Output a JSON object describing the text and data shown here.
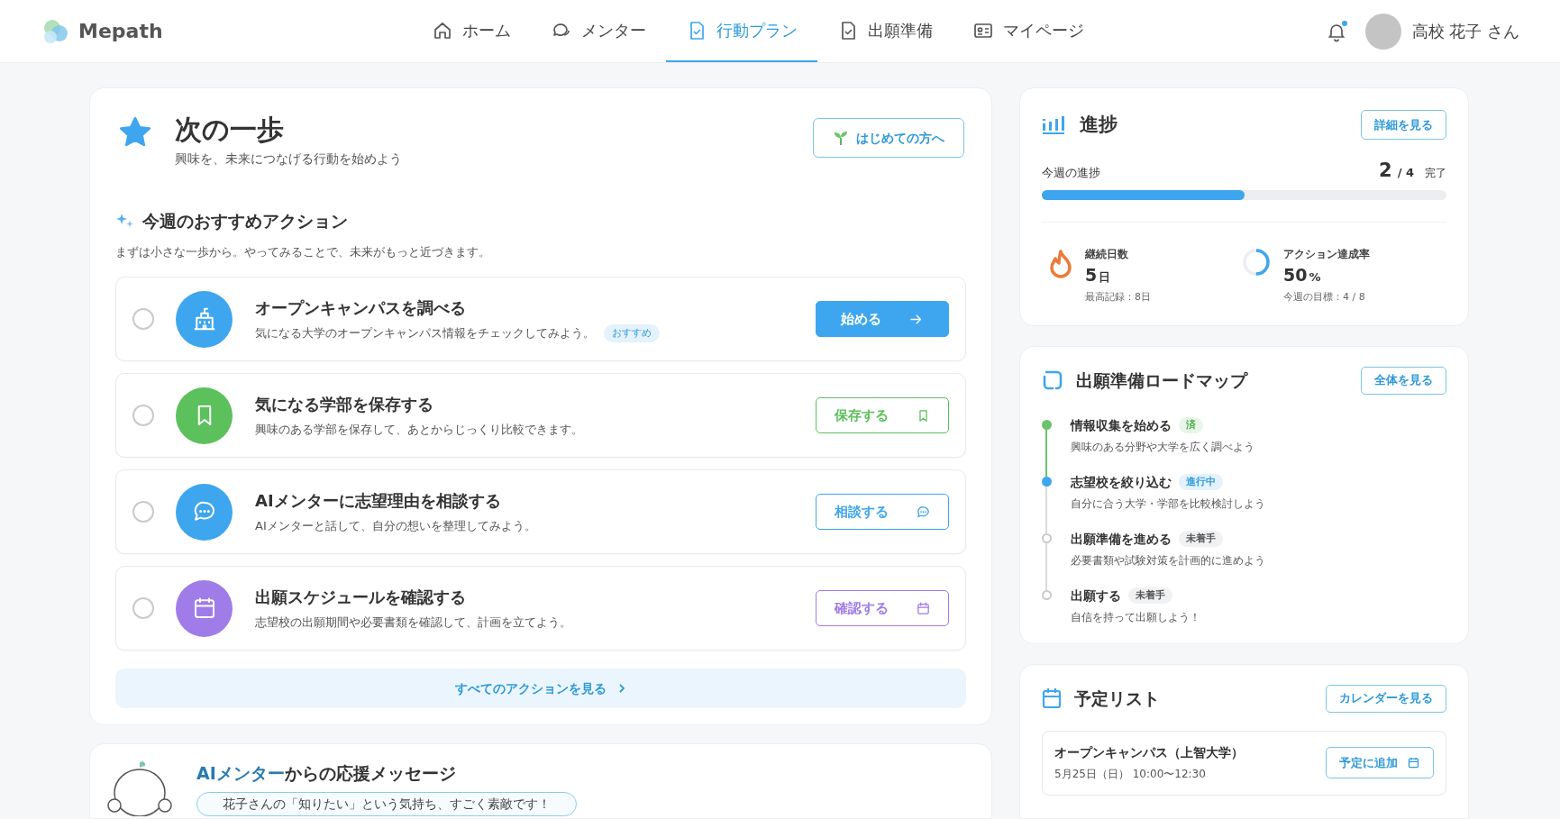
{
  "header": {
    "logo": "Mepath",
    "nav": [
      {
        "label": "ホーム",
        "selected": false
      },
      {
        "label": "メンター",
        "selected": false
      },
      {
        "label": "行動プラン",
        "selected": true
      },
      {
        "label": "出願準備",
        "selected": false
      },
      {
        "label": "マイページ",
        "selected": false
      }
    ],
    "notification": {
      "unread": true
    },
    "user": "高校 花子 さん"
  },
  "next_step": {
    "title": "次の一歩",
    "subtitle": "興味を、未来につなげる行動を始めよう",
    "guide_button": "はじめての方へ",
    "section_title": "今週のおすすめアクション",
    "section_desc": "まずは小さな一歩から。やってみることで、未来がもっと近づきます。",
    "actions": [
      {
        "title": "オープンキャンパスを調べる",
        "description": "気になる大学のオープンキャンパス情報をチェックしてみよう。",
        "badge": "おすすめ",
        "button": "始める",
        "kind": "filled",
        "color": "#3ea6ee",
        "checked": false
      },
      {
        "title": "気になる学部を保存する",
        "description": "興味のある学部を保存して、あとからじっくり比較できます。",
        "button": "保存する",
        "kind": "outline",
        "color": "#5cc05c",
        "checked": false
      },
      {
        "title": "AIメンターに志望理由を相談する",
        "description": "AIメンターと話して、自分の想いを整理してみよう。",
        "button": "相談する",
        "kind": "outline",
        "color": "#3ea6ee",
        "checked": false
      },
      {
        "title": "出願スケジュールを確認する",
        "description": "志望校の出願期間や必要書類を確認して、計画を立てよう。",
        "button": "確認する",
        "kind": "outline",
        "color": "#a07ce8",
        "checked": false
      }
    ],
    "see_all": "すべてのアクションを見る"
  },
  "ai_message": {
    "title_accent": "AIメンター",
    "title": "からの応援メッセージ",
    "message": "花子さんの「知りたい」という気持ち、すごく素敵です！"
  },
  "progress": {
    "title": "進捗",
    "detail_button": "詳細を見る",
    "week_label": "今週の進捗",
    "done": "2",
    "total": "/ 4",
    "done_label": "完了",
    "level": 0.5,
    "streak": {
      "label": "継続日数",
      "value": "5",
      "unit": "日",
      "note": "最高記録：8日"
    },
    "rate": {
      "label": "アクション達成率",
      "value": "50",
      "unit": "%",
      "note": "今週の目標：4 / 8",
      "level": 0.5
    }
  },
  "roadmap": {
    "title": "出願準備ロードマップ",
    "button": "全体を見る",
    "steps": [
      {
        "title": "情報収集を始める",
        "status": "済",
        "done": true,
        "current": false,
        "description": "興味のある分野や大学を広く調べよう"
      },
      {
        "title": "志望校を絞り込む",
        "status": "進行中",
        "done": false,
        "current": true,
        "description": "自分に合う大学・学部を比較検討しよう"
      },
      {
        "title": "出願準備を進める",
        "status": "未着手",
        "done": false,
        "current": false,
        "description": "必要書類や試験対策を計画的に進めよう"
      },
      {
        "title": "出願する",
        "status": "未着手",
        "done": false,
        "current": false,
        "description": "自信を持って出願しよう！"
      }
    ]
  },
  "schedule": {
    "title": "予定リスト",
    "button": "カレンダーを見る",
    "events": [
      {
        "title": "オープンキャンパス（上智大学）",
        "datetime": "5月25日（日） 10:00〜12:30",
        "button": "予定に追加"
      }
    ]
  }
}
